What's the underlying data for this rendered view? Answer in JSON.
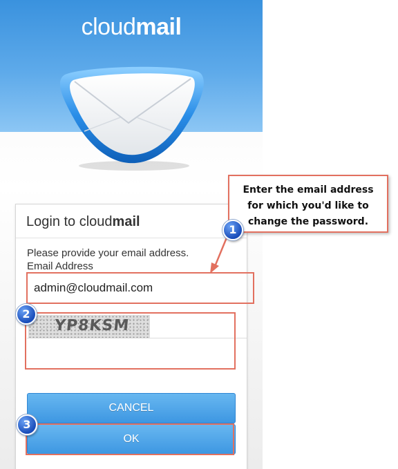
{
  "brand": {
    "name_light": "cloud",
    "name_bold": "mail"
  },
  "login": {
    "title_light": "Login to cloud",
    "title_bold": "mail",
    "instruction": "Please provide your email address.",
    "email_label": "Email Address",
    "email_value": "admin@cloudmail.com",
    "captcha_text": "YP8KSM",
    "captcha_value": "",
    "cancel_label": "CANCEL",
    "ok_label": "OK"
  },
  "annotations": {
    "callout_lines": [
      "Enter the email address",
      "for which you'd like to",
      "change the password."
    ],
    "steps": [
      "1",
      "2",
      "3"
    ]
  },
  "colors": {
    "header_blue": "#3a92de",
    "button_blue": "#3d97e2",
    "highlight": "#e2705f",
    "badge_blue": "#1a4dba"
  },
  "icons": {
    "envelope": "envelope-icon",
    "arrow": "callout-arrow-icon"
  }
}
